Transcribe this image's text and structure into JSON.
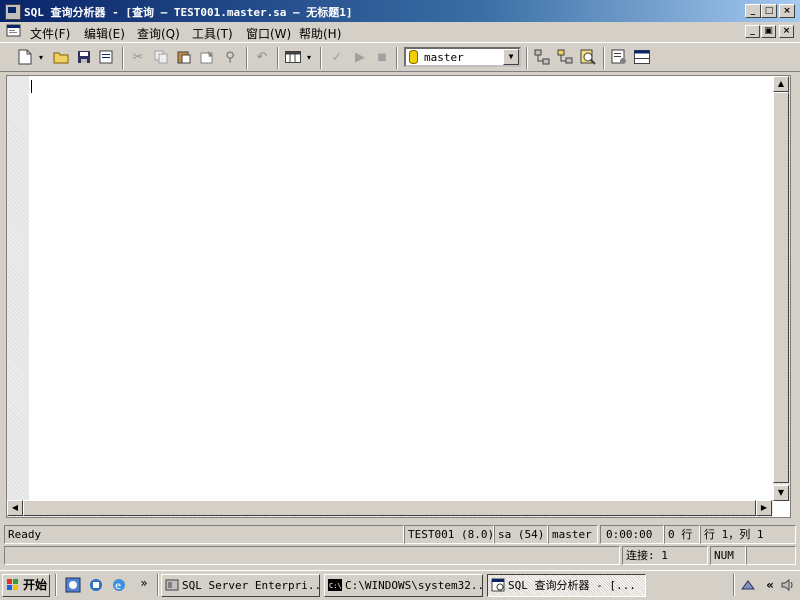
{
  "title_bar": {
    "title": "SQL 查询分析器 - [查询 — TEST001.master.sa — 无标题1]",
    "buttons": [
      "_",
      "□",
      "×"
    ]
  },
  "menu": {
    "items": [
      "文件(F)",
      "编辑(E)",
      "查询(Q)",
      "工具(T)",
      "窗口(W)",
      "帮助(H)"
    ],
    "mdi_buttons": [
      "_",
      "▣",
      "×"
    ]
  },
  "toolbar": {
    "database": "master"
  },
  "status_bar": {
    "state": "Ready",
    "server": "TEST001 (8.0)",
    "user": "sa (54)",
    "db": "master",
    "time": "0:00:00",
    "rows": "0 行",
    "position": "行 1，列 1",
    "connections": "连接: 1",
    "num": "NUM"
  },
  "taskbar": {
    "start": "开始",
    "overflow": "»",
    "tasks": [
      "SQL Server Enterpri...",
      "C:\\WINDOWS\\system32...",
      "SQL 查询分析器 - [..."
    ],
    "tray_overflow": "«"
  }
}
